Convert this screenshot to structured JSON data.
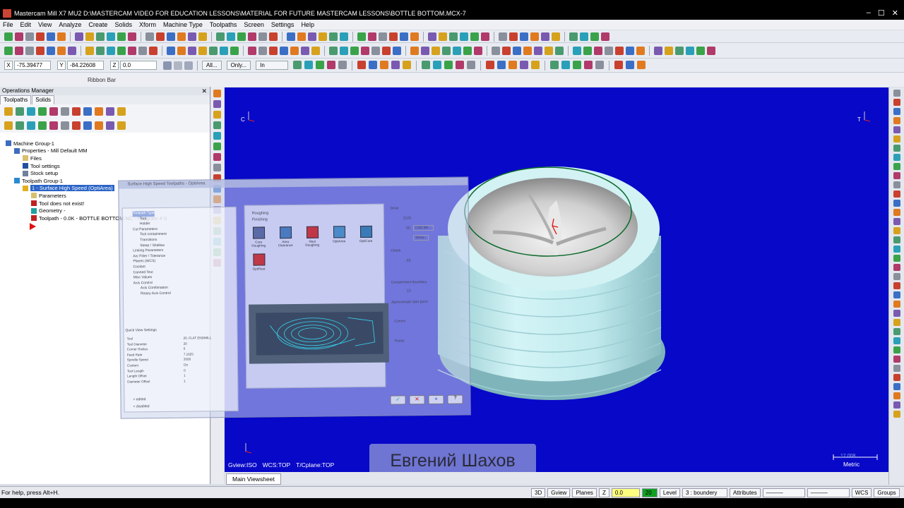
{
  "window": {
    "title": "Mastercam Mill X7 MU2  D:\\MASTERCAM VIDEO FOR EDUCATION LESSONS\\MATERIAL FOR FUTURE MASTERCAM LESSONS\\BOTTLE BOTTOM.MCX-7"
  },
  "menu": [
    "File",
    "Edit",
    "View",
    "Analyze",
    "Create",
    "Solids",
    "Xform",
    "Machine Type",
    "Toolpaths",
    "Screen",
    "Settings",
    "Help"
  ],
  "coords": {
    "x_label": "X",
    "x_value": "-75.39477",
    "y_label": "Y",
    "y_value": "-84.22608",
    "z_label": "Z",
    "z_value": "0.0",
    "all_label": "All...",
    "only_label": "Only...",
    "unit_value": "In"
  },
  "ribbon_label": "Ribbon Bar",
  "ops_manager": {
    "title": "Operations Manager",
    "tabs": [
      "Toolpaths",
      "Solids"
    ],
    "tree": [
      {
        "label": "Machine Group-1",
        "indent": 0,
        "icon": "#3d6cc0"
      },
      {
        "label": "Properties - Mill Default MM",
        "indent": 1,
        "icon": "#3d6cc0"
      },
      {
        "label": "Files",
        "indent": 2,
        "icon": "#d8c070"
      },
      {
        "label": "Tool settings",
        "indent": 2,
        "icon": "#2050a0"
      },
      {
        "label": "Stock setup",
        "indent": 2,
        "icon": "#7080a0"
      },
      {
        "label": "Toolpath Group-1",
        "indent": 1,
        "icon": "#2a8ad0"
      },
      {
        "label": "1 - Surface High Speed (OptiArea)",
        "indent": 2,
        "icon": "#e0b020",
        "selected": true
      },
      {
        "label": "Parameters",
        "indent": 3,
        "icon": "#d8c070"
      },
      {
        "label": "Tool does not exist!",
        "indent": 3,
        "icon": "#c02020"
      },
      {
        "label": "Geometry -",
        "indent": 3,
        "icon": "#20a0a0"
      },
      {
        "label": "Toolpath - 0.0K - BOTTLE BOTTOM.NC - Program # 0",
        "indent": 3,
        "icon": "#c02020"
      }
    ]
  },
  "dialog": {
    "title": "Surface High Speed Toolpaths - OptiArea",
    "tree": [
      "Toolpath Type",
      "Tool",
      "Holder",
      "Cut Parameters",
      "Tool containment",
      "Transitions",
      "Steep / Shallow",
      "Linking Parameters",
      "Arc Filter / Tolerance",
      "Planes (WCS)",
      "Coolant",
      "Canned Text",
      "Misc Values",
      "Axis Control",
      "Axis Combination",
      "Rotary Axis Control"
    ],
    "quick_view_title": "Quick View Settings",
    "quick_view": [
      [
        "Tool",
        "20. FLAT ENDMILL"
      ],
      [
        "Tool Diameter",
        "20"
      ],
      [
        "Corner Radius",
        "0"
      ],
      [
        "Feed Rate",
        "7.1625"
      ],
      [
        "Spindle Speed",
        "3500"
      ],
      [
        "Coolant",
        "On"
      ],
      [
        "Tool Length",
        "0"
      ],
      [
        "Length Offset",
        "1"
      ],
      [
        "Diameter Offset",
        "1"
      ]
    ],
    "legend_edited": "= edited",
    "legend_disabled": "= disabled",
    "options": [
      "Roughing",
      "Finishing"
    ],
    "strategies": [
      "Core Roughing",
      "Area Clearance",
      "Rest Roughing",
      "OptiArea",
      "OptiCore",
      "OptiRest"
    ],
    "right_labels": {
      "drive": "Drive",
      "drive_count": "(115)",
      "drive_count2": "(0)",
      "cad_file": "CAD file...",
      "show": "Show...",
      "check": "Check",
      "check_count": "(0)",
      "containment": "Containment boundary",
      "containment_count": "(1)",
      "start_point": "Approximate start point",
      "curves": "Curves",
      "points": "Points"
    }
  },
  "viewport": {
    "gview": "Gview:ISO",
    "wcs": "WCS:TOP",
    "tplane": "T/Cplane:TOP",
    "scale_value": "17.008",
    "scale_unit": "Metric",
    "background_color": "#0808c8",
    "part_color": "#c4eef0"
  },
  "watermark": "Евгений Шахов",
  "sheet_tab": "Main Viewsheet",
  "status": {
    "help": "For help, press Alt+H.",
    "3d": "3D",
    "gview": "Gview",
    "planes": "Planes",
    "z_label": "Z",
    "z_value": "0.0",
    "level_value": "20",
    "level_label": "Level",
    "level_name": "3 : boundery",
    "attributes": "Attributes",
    "wcs": "WCS",
    "groups": "Groups"
  }
}
